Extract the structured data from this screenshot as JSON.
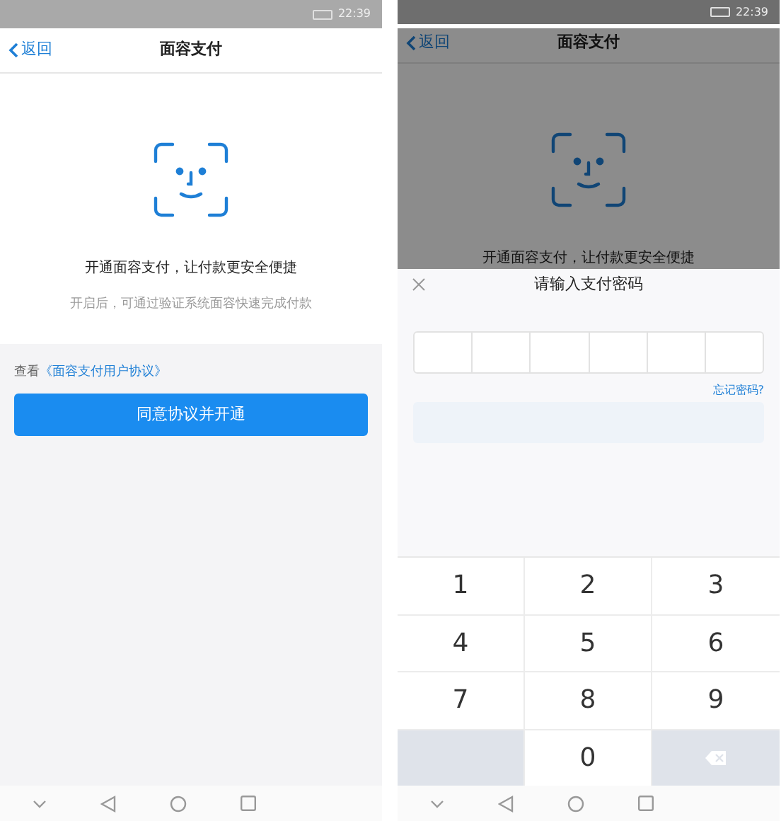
{
  "screens": [
    {
      "status_bar": {
        "time": "22:39"
      },
      "nav": {
        "back": "返回",
        "title": "面容支付"
      },
      "dimmed": false,
      "headline": "开通面容支付，让付款更安全便捷",
      "subtitle": "开启后，可通过验证系统面容快速完成付款",
      "agreement": {
        "prefix": "查看",
        "link": "《面容支付用户协议》"
      },
      "button": "同意协议并开通"
    },
    {
      "status_bar": {
        "time": "22:39"
      },
      "nav": {
        "back": "返回",
        "title": "面容支付"
      },
      "dimmed": true,
      "headline": "开通面容支付，让付款更安全便捷",
      "password_sheet": {
        "title": "请输入支付密码",
        "forgot": "忘记密码?",
        "confirm": {
          "disabled": true
        },
        "keys": [
          {
            "kind": "digit",
            "label": "1"
          },
          {
            "kind": "digit",
            "label": "2"
          },
          {
            "kind": "digit",
            "label": "3"
          },
          {
            "kind": "digit",
            "label": "4"
          },
          {
            "kind": "digit",
            "label": "5"
          },
          {
            "kind": "digit",
            "label": "6"
          },
          {
            "kind": "digit",
            "label": "7"
          },
          {
            "kind": "digit",
            "label": "8"
          },
          {
            "kind": "digit",
            "label": "9"
          },
          {
            "kind": "blank"
          },
          {
            "kind": "digit",
            "label": "0"
          },
          {
            "kind": "delete"
          }
        ]
      }
    }
  ]
}
